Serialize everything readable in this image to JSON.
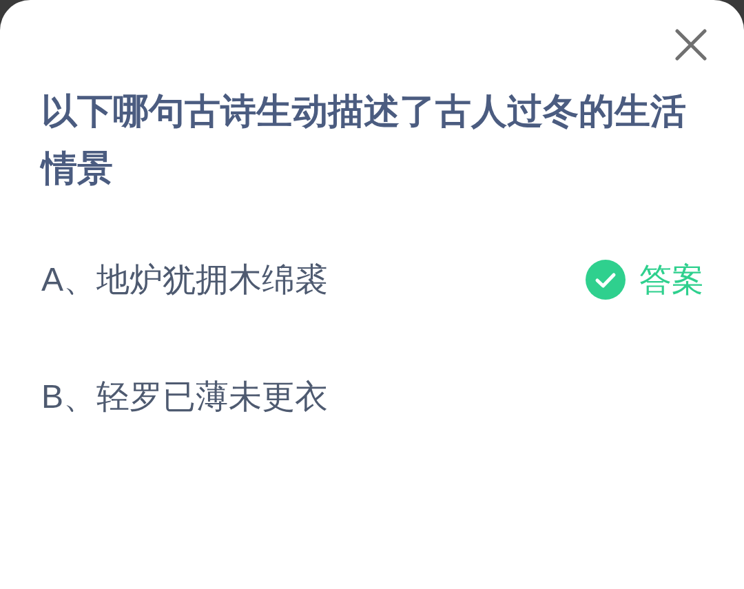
{
  "question": "以下哪句古诗生动描述了古人过冬的生活情景",
  "answer_label": "答案",
  "options": [
    {
      "text": "A、地炉犹拥木绵裘",
      "correct": true
    },
    {
      "text": "B、轻罗已薄未更衣",
      "correct": false
    }
  ]
}
